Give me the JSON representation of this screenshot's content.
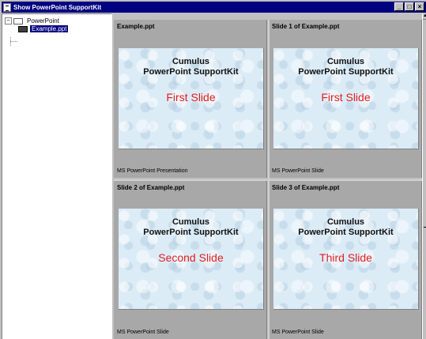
{
  "window": {
    "title": "Show PowerPoint SupportKit",
    "minimize_label": "_",
    "maximize_label": "□",
    "close_label": "×"
  },
  "tree": {
    "root": {
      "label": "PowerPoint",
      "expander": "−"
    },
    "child": {
      "label": "Example.ppt",
      "selected": true
    }
  },
  "cards": [
    {
      "title": "Example.ppt",
      "slide": {
        "line1": "Cumulus",
        "line2": "PowerPoint SupportKit",
        "subtitle": "First Slide"
      },
      "caption": "MS PowerPoint Presentation"
    },
    {
      "title": "Slide 1 of Example.ppt",
      "slide": {
        "line1": "Cumulus",
        "line2": "PowerPoint SupportKit",
        "subtitle": "First Slide"
      },
      "caption": "MS PowerPoint Slide"
    },
    {
      "title": "Slide 2 of Example.ppt",
      "slide": {
        "line1": "Cumulus",
        "line2": "PowerPoint SupportKit",
        "subtitle": "Second Slide"
      },
      "caption": "MS PowerPoint Slide"
    },
    {
      "title": "Slide 3 of Example.ppt",
      "slide": {
        "line1": "Cumulus",
        "line2": "PowerPoint SupportKit",
        "subtitle": "Third Slide"
      },
      "caption": "MS PowerPoint Slide"
    }
  ],
  "colors": {
    "titlebar": "#000080",
    "selection": "#000080",
    "slide_background": "#dcecf7",
    "slide_subtitle": "#e21d1d"
  }
}
